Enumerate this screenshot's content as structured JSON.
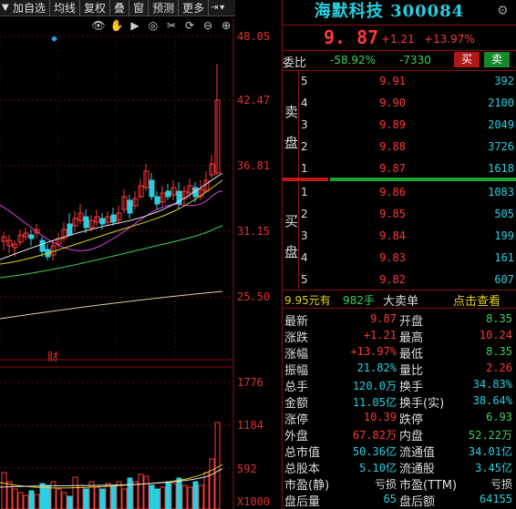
{
  "toolbar": {
    "items": [
      "加自选",
      "均线",
      "复权",
      "叠",
      "窗",
      "预测",
      "更多"
    ]
  },
  "chart": {
    "price_ticks": [
      "48.05",
      "42.47",
      "36.81",
      "31.15",
      "25.50"
    ],
    "vol_ticks": [
      "1776",
      "1184",
      "592",
      "X1000"
    ],
    "caption": "财"
  },
  "stock": {
    "name": "海默科技",
    "code": "300084",
    "price": "9. 87",
    "change": "+1.21",
    "change_pct": "+13.97%"
  },
  "weibi": {
    "label": "委比",
    "pct": "-58.92%",
    "diff": "-7330",
    "buy_label": "买",
    "sell_label": "卖"
  },
  "orderbook": {
    "sell_side_label": [
      "卖",
      "盘"
    ],
    "buy_side_label": [
      "买",
      "盘"
    ],
    "asks": [
      {
        "level": "5",
        "price": "9.91",
        "volume": "392"
      },
      {
        "level": "4",
        "price": "9.90",
        "volume": "2100"
      },
      {
        "level": "3",
        "price": "9.89",
        "volume": "2049"
      },
      {
        "level": "2",
        "price": "9.88",
        "volume": "3726"
      },
      {
        "level": "1",
        "price": "9.87",
        "volume": "1618"
      }
    ],
    "bids": [
      {
        "level": "1",
        "price": "9.86",
        "volume": "1083"
      },
      {
        "level": "2",
        "price": "9.85",
        "volume": "505"
      },
      {
        "level": "3",
        "price": "9.84",
        "volume": "199"
      },
      {
        "level": "4",
        "price": "9.83",
        "volume": "161"
      },
      {
        "level": "5",
        "price": "9.82",
        "volume": "607"
      }
    ]
  },
  "big_order": {
    "price": "9.95元有",
    "qty": "982手",
    "text": "大卖单",
    "link": "点击查看"
  },
  "stats": {
    "left": [
      {
        "label": "最新",
        "value": "9.87",
        "color": "red"
      },
      {
        "label": "涨跌",
        "value": "+1.21",
        "color": "red"
      },
      {
        "label": "涨幅",
        "value": "+13.97%",
        "color": "red"
      },
      {
        "label": "振幅",
        "value": "21.82%",
        "color": "cyan"
      },
      {
        "label": "总手",
        "value": "120.0万",
        "color": "cyan"
      },
      {
        "label": "金额",
        "value": "11.05亿",
        "color": "cyan"
      },
      {
        "label": "涨停",
        "value": "10.39",
        "color": "red"
      },
      {
        "label": "外盘",
        "value": "67.82万",
        "color": "red"
      },
      {
        "label": "总市值",
        "value": "50.36亿",
        "color": "cyan"
      },
      {
        "label": "总股本",
        "value": "5.10亿",
        "color": "cyan"
      },
      {
        "label": "市盈(静)",
        "value": "亏损",
        "color": "white"
      },
      {
        "label": "盘后量",
        "value": "65",
        "color": "cyan"
      }
    ],
    "right": [
      {
        "label": "开盘",
        "value": "8.35",
        "color": "green"
      },
      {
        "label": "最高",
        "value": "10.24",
        "color": "red"
      },
      {
        "label": "最低",
        "value": "8.35",
        "color": "green"
      },
      {
        "label": "量比",
        "value": "2.26",
        "color": "red"
      },
      {
        "label": "换手",
        "value": "34.83%",
        "color": "cyan"
      },
      {
        "label": "换手(实)",
        "value": "38.64%",
        "color": "cyan"
      },
      {
        "label": "跌停",
        "value": "6.93",
        "color": "green"
      },
      {
        "label": "内盘",
        "value": "52.22万",
        "color": "green"
      },
      {
        "label": "流通值",
        "value": "34.01亿",
        "color": "cyan"
      },
      {
        "label": "流通股",
        "value": "3.45亿",
        "color": "cyan"
      },
      {
        "label": "市盈(TTM)",
        "value": "亏损",
        "color": "white"
      },
      {
        "label": "盘后额",
        "value": "64155",
        "color": "cyan"
      }
    ]
  }
}
